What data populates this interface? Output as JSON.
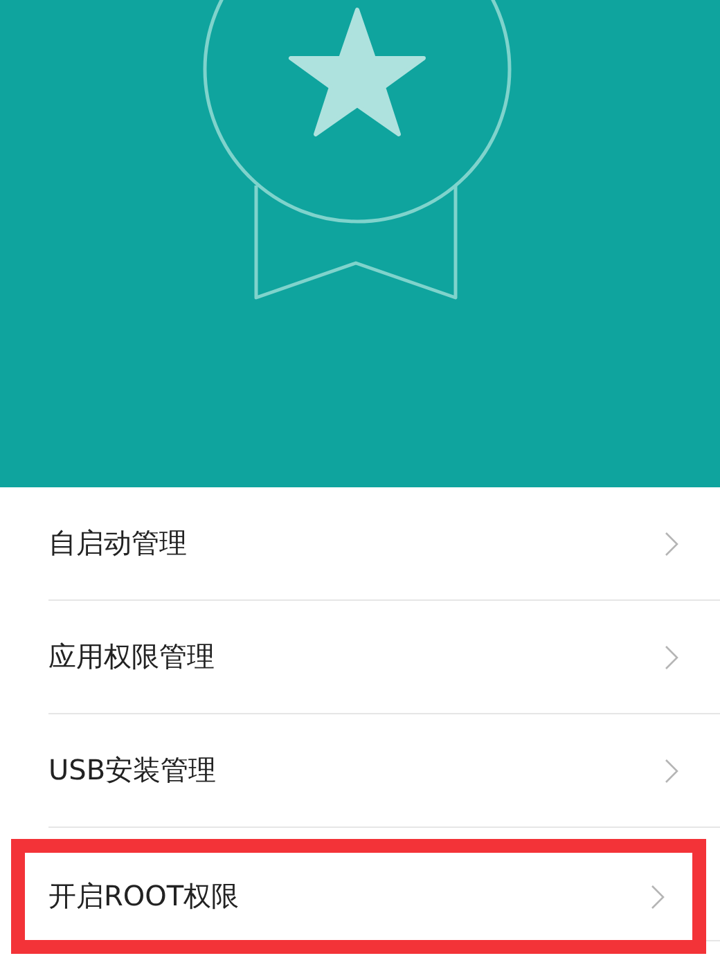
{
  "items": [
    {
      "label": "自启动管理",
      "highlighted": false
    },
    {
      "label": "应用权限管理",
      "highlighted": false
    },
    {
      "label": "USB安装管理",
      "highlighted": false
    },
    {
      "label": "开启ROOT权限",
      "highlighted": true
    }
  ]
}
